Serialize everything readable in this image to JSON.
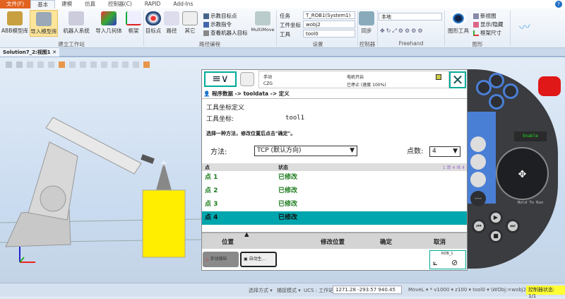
{
  "menubar": {
    "tabs": [
      "文件(F)",
      "基本",
      "建模",
      "仿真",
      "控制器(C)",
      "RAPID",
      "Add-Ins"
    ]
  },
  "ribbon": {
    "build_station": {
      "label": "建立工作站",
      "buttons": [
        "ABB模型库",
        "导入模型库",
        "机器人系统",
        "导入几何体",
        "框架"
      ]
    },
    "path_programming": {
      "label": "路径编程",
      "buttons": [
        "目标点",
        "路径",
        "其它"
      ],
      "small": [
        "示教目标点",
        "示教指令",
        "查看机器人目标"
      ],
      "multimove": "MultiMove"
    },
    "settings": {
      "label": "设置",
      "task_label": "任务",
      "task_value": "T_ROB1(System1)",
      "wobj_label": "工件坐标",
      "wobj_value": "wobj2",
      "tool_label": "工具",
      "tool_value": "tool0"
    },
    "controller": {
      "label": "控制器",
      "sync": "同步"
    },
    "freehand": {
      "label": "Freehand",
      "frame_value": "本地"
    },
    "graphics": {
      "label": "图形",
      "tools": "图形工具",
      "small": [
        "新视图",
        "显示/隐藏",
        "框架尺寸"
      ]
    }
  },
  "doc_tab": "Solution7_2:视图1",
  "pendant": {
    "mode": "手动",
    "controller": "CZG",
    "motor": "电机开启",
    "state": "已停止 (速度 100%)",
    "breadcrumb": "程序数据 -> tooldata -> 定义",
    "title": "工具坐标定义",
    "tool_label": "工具坐标:",
    "tool_value": "tool1",
    "instruction": "选择一种方法，修改位置后点击\"确定\"。",
    "method_label": "方法:",
    "method_value": "TCP (默认方向)",
    "points_label": "点数:",
    "points_value": "4",
    "table": {
      "headers": [
        "点",
        "状态"
      ],
      "paging": "1 到 4 共 4",
      "rows": [
        {
          "point": "点  1",
          "status": "已修改"
        },
        {
          "point": "点  2",
          "status": "已修改"
        },
        {
          "point": "点  3",
          "status": "已修改"
        },
        {
          "point": "点  4",
          "status": "已修改",
          "selected": true
        }
      ]
    },
    "buttons": {
      "position": "位置",
      "modify": "修改位置",
      "ok": "确定",
      "cancel": "取消"
    },
    "taskbar": [
      "手动操纵",
      "自动生..."
    ],
    "rob": "ROB_1",
    "enable": "Enable",
    "hold": "Hold To Run"
  },
  "statusbar": {
    "select_mode": "选择方式 ▾",
    "snap_mode": "捕捉模式 ▾",
    "ucs": "UCS : 工作站",
    "coords": "1271.28   -293.57   940.45",
    "instruction": "MoveL ▾ * v1000 ▾ z100 ▾ tool0 ▾ \\WObj:=wobj2 ▾",
    "controller_status": "控制器状态:  1/1"
  },
  "colors": {
    "accent": "#e2621f",
    "teal": "#00a6ae",
    "green": "#1a7a1a",
    "highlight": "#ffff33"
  }
}
